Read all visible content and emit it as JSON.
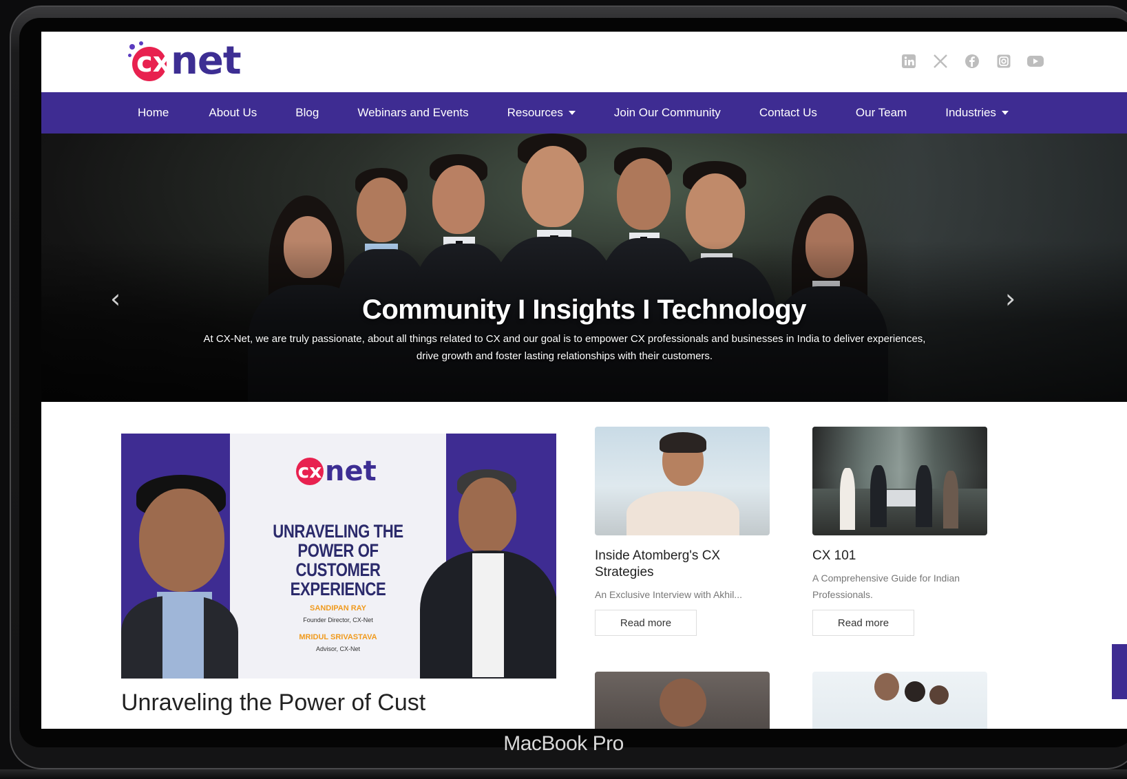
{
  "device": {
    "label": "MacBook Pro"
  },
  "header": {
    "logo_text": "net",
    "logo_mark": "cx",
    "social_icons": [
      "linkedin-icon",
      "x-icon",
      "facebook-icon",
      "instagram-icon",
      "youtube-icon"
    ]
  },
  "nav": {
    "items": [
      {
        "label": "Home"
      },
      {
        "label": "About Us"
      },
      {
        "label": "Blog"
      },
      {
        "label": "Webinars and Events"
      },
      {
        "label": "Resources",
        "dropdown": true
      },
      {
        "label": "Join Our Community"
      },
      {
        "label": "Contact Us"
      },
      {
        "label": "Our Team"
      },
      {
        "label": "Industries",
        "dropdown": true
      }
    ]
  },
  "hero": {
    "title": "Community I Insights I Technology",
    "subtitle": "At CX-Net, we are truly passionate, about all things related to CX and our goal is to empower CX professionals and businesses in India to deliver experiences, drive growth and foster lasting relationships with their customers.",
    "prev_arrow": "‹",
    "next_arrow": "›"
  },
  "feature": {
    "logo_text": "net",
    "logo_mark": "cx",
    "headline": "UNRAVELING THE POWER OF CUSTOMER EXPERIENCE",
    "person1_name": "SANDIPAN RAY",
    "person1_role": "Founder Director, CX-Net",
    "person2_name": "MRIDUL SRIVASTAVA",
    "person2_role": "Advisor, CX-Net",
    "partial_title": "Unraveling the Power of Cust"
  },
  "cards": [
    {
      "title": "Inside Atomberg's CX Strategies",
      "desc": "An Exclusive Interview with Akhil...",
      "button": "Read more"
    },
    {
      "title": "CX 101",
      "desc": "A Comprehensive Guide for Indian Professionals.",
      "button": "Read more"
    }
  ],
  "colors": {
    "brand_purple": "#3e2c92",
    "brand_red": "#e8214f"
  }
}
